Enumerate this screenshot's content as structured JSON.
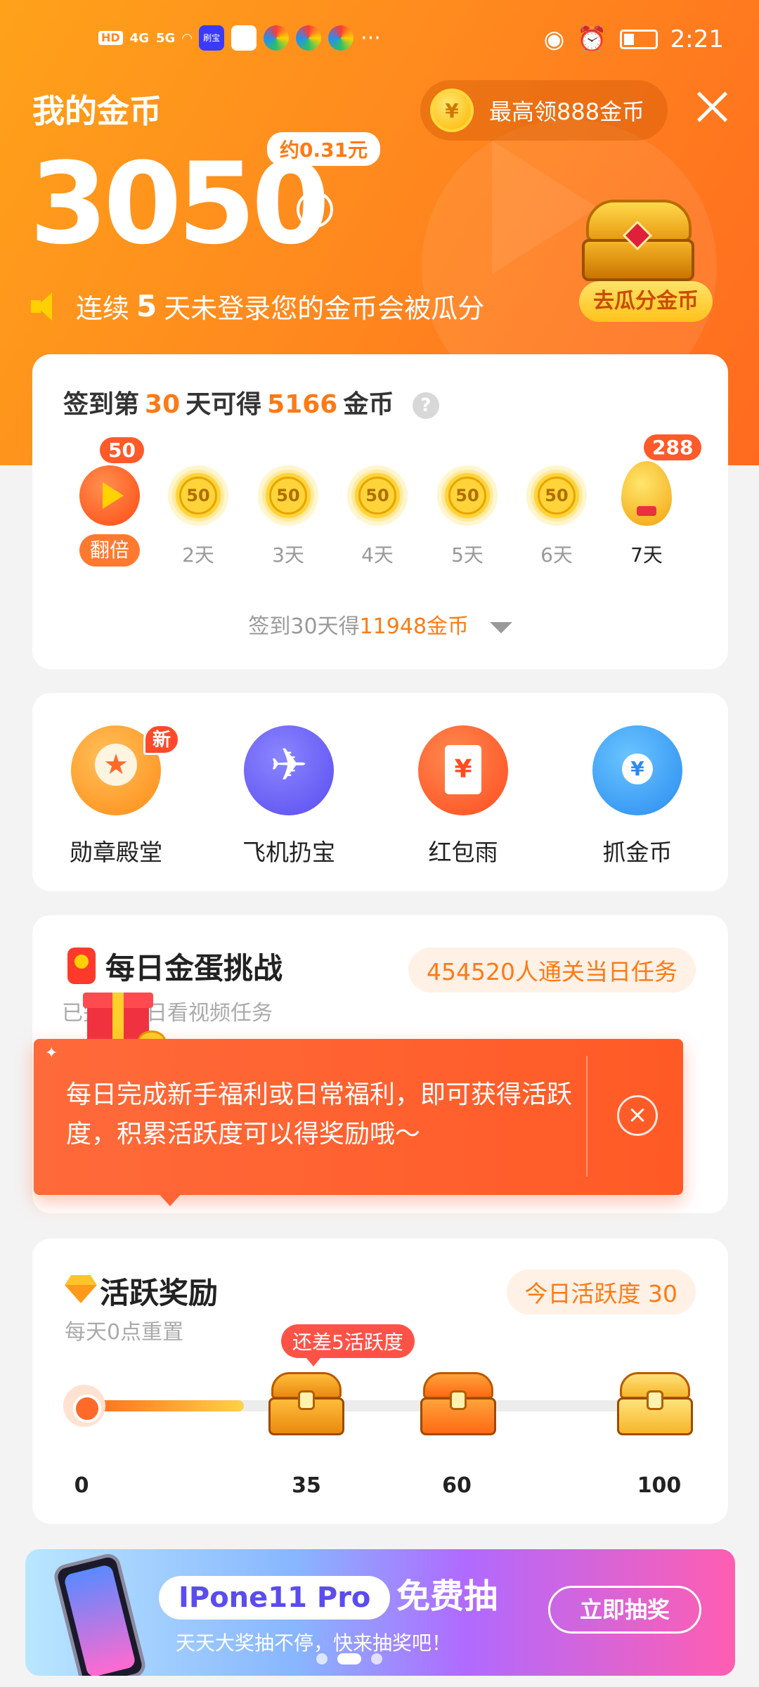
{
  "status_bar": {
    "time": "2:21",
    "hd1": "HD",
    "hd2": "HD",
    "net1": "4G",
    "net2": "5G",
    "more": "···",
    "app_label": "刷宝"
  },
  "header": {
    "title": "我的金币",
    "max_reward": "最高领888金币",
    "coin_symbol": "¥",
    "coins": "3050",
    "approx_value": "约0.31元",
    "warning_prefix": "连续",
    "warning_days": "5",
    "warning_suffix": "天未登录您的金币会被瓜分",
    "share_button": "去瓜分金币"
  },
  "sign_in": {
    "title_a": "签到第",
    "title_day": "30",
    "title_b": "天可得",
    "title_coins": "5166",
    "title_c": "金币",
    "help": "?",
    "days": [
      {
        "label": "翻倍",
        "badge": "50"
      },
      {
        "label": "2天",
        "value": "50"
      },
      {
        "label": "3天",
        "value": "50"
      },
      {
        "label": "4天",
        "value": "50"
      },
      {
        "label": "5天",
        "value": "50"
      },
      {
        "label": "6天",
        "value": "50"
      },
      {
        "label": "7天",
        "badge": "288"
      }
    ],
    "footer_a": "签到30天得",
    "footer_b": "11948金币"
  },
  "features": {
    "items": [
      {
        "label": "勋章殿堂",
        "icon": "medal-icon"
      },
      {
        "label": "飞机扔宝",
        "icon": "plane-icon"
      },
      {
        "label": "红包雨",
        "icon": "red-packet-icon"
      },
      {
        "label": "抓金币",
        "icon": "claw-icon"
      }
    ],
    "new_badge": "新"
  },
  "egg_challenge": {
    "title": "每日金蛋挑战",
    "subtitle": "已完成今日看视频任务",
    "participants": "454520人通关当日任务"
  },
  "tooltip": {
    "text": "每日完成新手福利或日常福利，即可获得活跃度，积累活跃度可以得奖励哦～",
    "close": "×"
  },
  "activity": {
    "title": "活跃奖励",
    "subtitle": "每天0点重置",
    "today": "今日活跃度 30",
    "need": "还差5活跃度",
    "progress": 30,
    "max": 100,
    "ticks": [
      "0",
      "35",
      "60",
      "100"
    ]
  },
  "banner": {
    "product": "IPone11 Pro",
    "free": "免费抽",
    "subtitle": "天天大奖抽不停，快来抽奖吧！",
    "button": "立即抽奖"
  },
  "colors": {
    "accent": "#ff7a14",
    "header_bg": "#ff8a1e",
    "tooltip_bg": "#ff5a26"
  }
}
